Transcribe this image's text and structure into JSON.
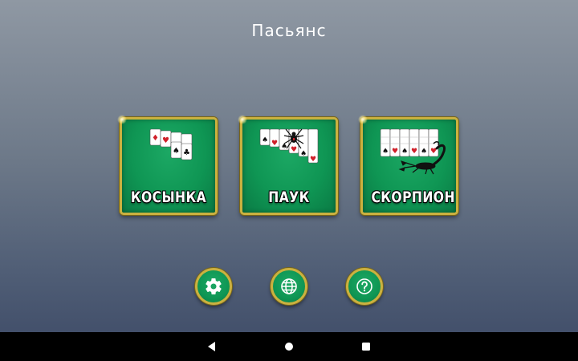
{
  "header": {
    "title": "Пасьянс"
  },
  "games": [
    {
      "label": "КОСЫНКА",
      "art_icon": "cards-fan-icon"
    },
    {
      "label": "ПАУК",
      "art_icon": "spider-cards-icon"
    },
    {
      "label": "СКОРПИОН",
      "art_icon": "scorpion-cards-icon"
    }
  ],
  "toolbar": {
    "settings_icon": "gear-icon",
    "language_icon": "globe-icon",
    "help_icon": "question-icon"
  },
  "navigation": {
    "back_icon": "back-triangle-icon",
    "home_icon": "home-circle-icon",
    "recents_icon": "recents-square-icon"
  },
  "colors": {
    "felt_green": "#0f9654",
    "gold_border": "#cbb13f",
    "card_red": "#d0202a",
    "background_top": "#8f98a3",
    "background_bottom": "#3d4a66"
  }
}
